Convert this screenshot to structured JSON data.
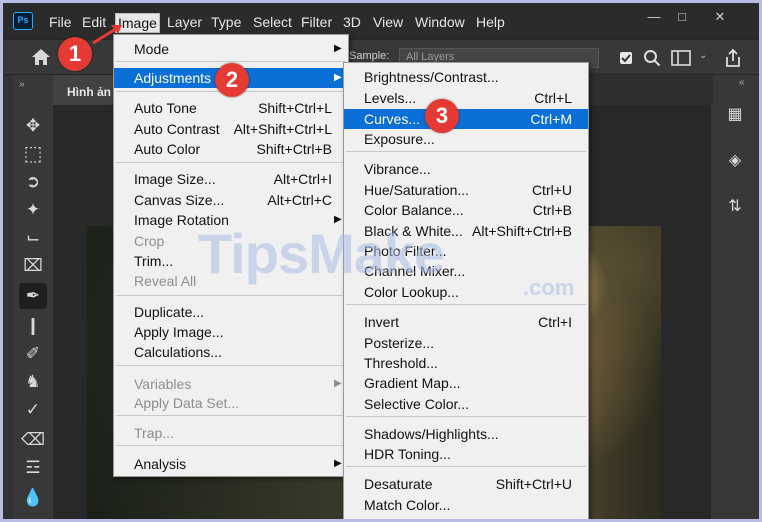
{
  "app": {
    "logo_text": "Ps"
  },
  "menubar": {
    "items": [
      "File",
      "Edit",
      "Image",
      "Layer",
      "Type",
      "Select",
      "Filter",
      "3D",
      "View",
      "Window",
      "Help"
    ],
    "active": "Image"
  },
  "options_bar": {
    "sample_label": "Sample:",
    "sample_value": "All Layers"
  },
  "document": {
    "tab_title": "Hình ản"
  },
  "image_menu": {
    "items": [
      {
        "label": "Mode",
        "submenu": true
      },
      {
        "label": "Adjustments",
        "submenu": true,
        "highlighted": true
      },
      {
        "label": "Auto Tone",
        "shortcut": "Shift+Ctrl+L"
      },
      {
        "label": "Auto Contrast",
        "shortcut": "Alt+Shift+Ctrl+L"
      },
      {
        "label": "Auto Color",
        "shortcut": "Shift+Ctrl+B"
      },
      {
        "label": "Image Size...",
        "shortcut": "Alt+Ctrl+I"
      },
      {
        "label": "Canvas Size...",
        "shortcut": "Alt+Ctrl+C"
      },
      {
        "label": "Image Rotation",
        "submenu": true
      },
      {
        "label": "Crop",
        "disabled": true
      },
      {
        "label": "Trim..."
      },
      {
        "label": "Reveal All",
        "disabled": true
      },
      {
        "label": "Duplicate..."
      },
      {
        "label": "Apply Image..."
      },
      {
        "label": "Calculations..."
      },
      {
        "label": "Variables",
        "disabled": true,
        "submenu": true
      },
      {
        "label": "Apply Data Set...",
        "disabled": true
      },
      {
        "label": "Trap...",
        "disabled": true
      },
      {
        "label": "Analysis",
        "submenu": true
      }
    ]
  },
  "adjustments_menu": {
    "items": [
      {
        "label": "Brightness/Contrast..."
      },
      {
        "label": "Levels...",
        "shortcut": "Ctrl+L"
      },
      {
        "label": "Curves...",
        "shortcut": "Ctrl+M",
        "highlighted": true
      },
      {
        "label": "Exposure..."
      },
      {
        "label": "Vibrance..."
      },
      {
        "label": "Hue/Saturation...",
        "shortcut": "Ctrl+U"
      },
      {
        "label": "Color Balance...",
        "shortcut": "Ctrl+B"
      },
      {
        "label": "Black & White...",
        "shortcut": "Alt+Shift+Ctrl+B"
      },
      {
        "label": "Photo Filter..."
      },
      {
        "label": "Channel Mixer..."
      },
      {
        "label": "Color Lookup..."
      },
      {
        "label": "Invert",
        "shortcut": "Ctrl+I"
      },
      {
        "label": "Posterize..."
      },
      {
        "label": "Threshold..."
      },
      {
        "label": "Gradient Map..."
      },
      {
        "label": "Selective Color..."
      },
      {
        "label": "Shadows/Highlights..."
      },
      {
        "label": "HDR Toning..."
      },
      {
        "label": "Desaturate",
        "shortcut": "Shift+Ctrl+U"
      },
      {
        "label": "Match Color..."
      }
    ]
  },
  "step_badges": [
    "1",
    "2",
    "3"
  ],
  "watermark": {
    "text": "TipsMake",
    "suffix": ".com"
  },
  "colors": {
    "highlight": "#0a6fd6",
    "badge": "#e53a33",
    "frame_border": "#b9bde6"
  }
}
